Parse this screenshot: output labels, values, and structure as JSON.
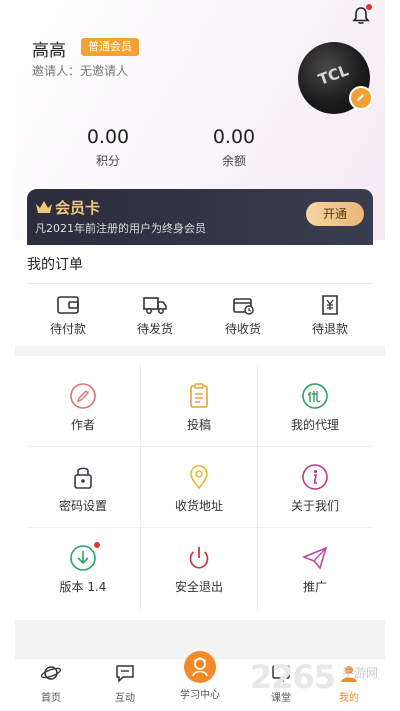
{
  "profile": {
    "name": "高高",
    "badge": "普通会员",
    "inviter": "邀请人：无邀请人",
    "avatar_text": "TCL"
  },
  "stats": [
    {
      "value": "0.00",
      "label": "积分"
    },
    {
      "value": "0.00",
      "label": "余额"
    }
  ],
  "vip_card": {
    "title": "会员卡",
    "desc": "凡2021年前注册的用户为终身会员",
    "button": "开通"
  },
  "orders": {
    "title": "我的订单",
    "items": [
      {
        "label": "待付款",
        "icon": "wallet-icon"
      },
      {
        "label": "待发货",
        "icon": "truck-icon"
      },
      {
        "label": "待收货",
        "icon": "receive-box-icon"
      },
      {
        "label": "待退款",
        "icon": "refund-icon"
      }
    ]
  },
  "menu": [
    {
      "label": "作者",
      "icon": "pencil-icon",
      "color": "#e0726f"
    },
    {
      "label": "投稿",
      "icon": "clipboard-icon",
      "color": "#e6a23a"
    },
    {
      "label": "我的代理",
      "icon": "agent-icon",
      "color": "#2fa35c"
    },
    {
      "label": "密码设置",
      "icon": "lock-icon",
      "color": "#3a3a4a"
    },
    {
      "label": "收货地址",
      "icon": "location-pin-icon",
      "color": "#e6b82a"
    },
    {
      "label": "关于我们",
      "icon": "info-icon",
      "color": "#b93d8c"
    },
    {
      "label": "版本 1.4",
      "icon": "download-icon",
      "color": "#2aa66b"
    },
    {
      "label": "安全退出",
      "icon": "power-icon",
      "color": "#c23a45"
    },
    {
      "label": "推广",
      "icon": "paper-plane-icon",
      "color": "#b94d9b"
    }
  ],
  "tabbar": [
    {
      "label": "首页",
      "icon": "planet-icon"
    },
    {
      "label": "互动",
      "icon": "chat-icon"
    },
    {
      "label": "学习中心",
      "icon": "study-icon"
    },
    {
      "label": "课堂",
      "icon": "classroom-icon"
    },
    {
      "label": "我的",
      "icon": "user-icon"
    }
  ],
  "watermark": {
    "number": "2265",
    "text": "手游网"
  },
  "colors": {
    "accent": "#f28a2c",
    "badge": "#f3a133",
    "vip_bg": "#2b2d3d",
    "vip_gold": "#f0c77a"
  }
}
